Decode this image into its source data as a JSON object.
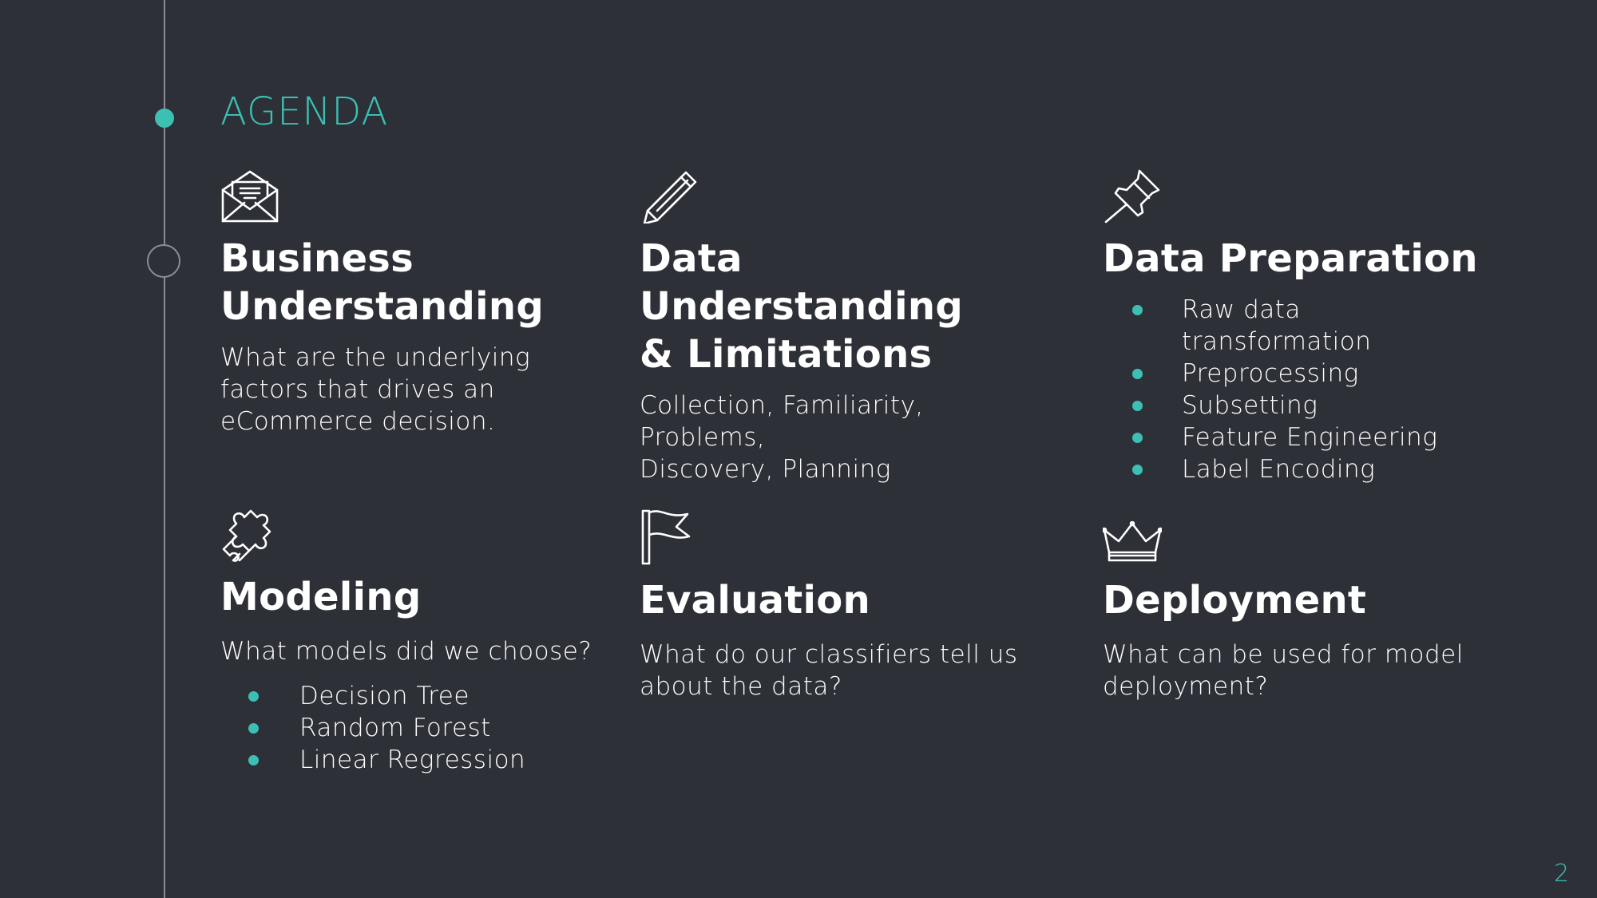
{
  "slide": {
    "title": "AGENDA",
    "page_number": "2",
    "colors": {
      "background": "#2e3038",
      "accent": "#3cc0b4",
      "text": "#ffffff",
      "timeline": "#8a8d93"
    }
  },
  "items": {
    "business": {
      "icon": "envelope-icon",
      "title_line1": "Business",
      "title_line2": "Understanding",
      "desc_line1": "What are the underlying",
      "desc_line2": "factors that drives an",
      "desc_line3": "eCommerce decision."
    },
    "data_understanding": {
      "icon": "pencil-icon",
      "title_line1": "Data Understanding",
      "title_line2": "& Limitations",
      "desc_line1": "Collection, Familiarity, Problems,",
      "desc_line2": "Discovery, Planning"
    },
    "data_preparation": {
      "icon": "pushpin-icon",
      "title": "Data Preparation",
      "bullets": [
        "Raw data",
        "transformation",
        "Preprocessing",
        "Subsetting",
        "Feature Engineering",
        "Label Encoding"
      ]
    },
    "modeling": {
      "icon": "puzzle-icon",
      "title": "Modeling",
      "desc": "What models did we choose?",
      "bullets": [
        "Decision Tree",
        "Random Forest",
        "Linear Regression"
      ]
    },
    "evaluation": {
      "icon": "flag-icon",
      "title": "Evaluation",
      "desc_line1": "What do our classifiers tell us",
      "desc_line2": "about the data?"
    },
    "deployment": {
      "icon": "crown-icon",
      "title": "Deployment",
      "desc_line1": "What can be used for model",
      "desc_line2": "deployment?"
    }
  }
}
